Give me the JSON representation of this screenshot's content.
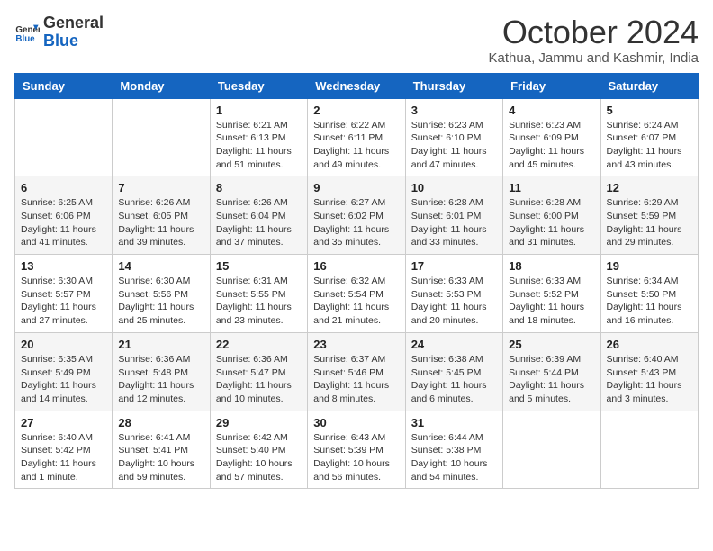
{
  "header": {
    "logo_line1": "General",
    "logo_line2": "Blue",
    "month": "October 2024",
    "location": "Kathua, Jammu and Kashmir, India"
  },
  "weekdays": [
    "Sunday",
    "Monday",
    "Tuesday",
    "Wednesday",
    "Thursday",
    "Friday",
    "Saturday"
  ],
  "weeks": [
    [
      {
        "day": "",
        "sunrise": "",
        "sunset": "",
        "daylight": ""
      },
      {
        "day": "",
        "sunrise": "",
        "sunset": "",
        "daylight": ""
      },
      {
        "day": "1",
        "sunrise": "Sunrise: 6:21 AM",
        "sunset": "Sunset: 6:13 PM",
        "daylight": "Daylight: 11 hours and 51 minutes."
      },
      {
        "day": "2",
        "sunrise": "Sunrise: 6:22 AM",
        "sunset": "Sunset: 6:11 PM",
        "daylight": "Daylight: 11 hours and 49 minutes."
      },
      {
        "day": "3",
        "sunrise": "Sunrise: 6:23 AM",
        "sunset": "Sunset: 6:10 PM",
        "daylight": "Daylight: 11 hours and 47 minutes."
      },
      {
        "day": "4",
        "sunrise": "Sunrise: 6:23 AM",
        "sunset": "Sunset: 6:09 PM",
        "daylight": "Daylight: 11 hours and 45 minutes."
      },
      {
        "day": "5",
        "sunrise": "Sunrise: 6:24 AM",
        "sunset": "Sunset: 6:07 PM",
        "daylight": "Daylight: 11 hours and 43 minutes."
      }
    ],
    [
      {
        "day": "6",
        "sunrise": "Sunrise: 6:25 AM",
        "sunset": "Sunset: 6:06 PM",
        "daylight": "Daylight: 11 hours and 41 minutes."
      },
      {
        "day": "7",
        "sunrise": "Sunrise: 6:26 AM",
        "sunset": "Sunset: 6:05 PM",
        "daylight": "Daylight: 11 hours and 39 minutes."
      },
      {
        "day": "8",
        "sunrise": "Sunrise: 6:26 AM",
        "sunset": "Sunset: 6:04 PM",
        "daylight": "Daylight: 11 hours and 37 minutes."
      },
      {
        "day": "9",
        "sunrise": "Sunrise: 6:27 AM",
        "sunset": "Sunset: 6:02 PM",
        "daylight": "Daylight: 11 hours and 35 minutes."
      },
      {
        "day": "10",
        "sunrise": "Sunrise: 6:28 AM",
        "sunset": "Sunset: 6:01 PM",
        "daylight": "Daylight: 11 hours and 33 minutes."
      },
      {
        "day": "11",
        "sunrise": "Sunrise: 6:28 AM",
        "sunset": "Sunset: 6:00 PM",
        "daylight": "Daylight: 11 hours and 31 minutes."
      },
      {
        "day": "12",
        "sunrise": "Sunrise: 6:29 AM",
        "sunset": "Sunset: 5:59 PM",
        "daylight": "Daylight: 11 hours and 29 minutes."
      }
    ],
    [
      {
        "day": "13",
        "sunrise": "Sunrise: 6:30 AM",
        "sunset": "Sunset: 5:57 PM",
        "daylight": "Daylight: 11 hours and 27 minutes."
      },
      {
        "day": "14",
        "sunrise": "Sunrise: 6:30 AM",
        "sunset": "Sunset: 5:56 PM",
        "daylight": "Daylight: 11 hours and 25 minutes."
      },
      {
        "day": "15",
        "sunrise": "Sunrise: 6:31 AM",
        "sunset": "Sunset: 5:55 PM",
        "daylight": "Daylight: 11 hours and 23 minutes."
      },
      {
        "day": "16",
        "sunrise": "Sunrise: 6:32 AM",
        "sunset": "Sunset: 5:54 PM",
        "daylight": "Daylight: 11 hours and 21 minutes."
      },
      {
        "day": "17",
        "sunrise": "Sunrise: 6:33 AM",
        "sunset": "Sunset: 5:53 PM",
        "daylight": "Daylight: 11 hours and 20 minutes."
      },
      {
        "day": "18",
        "sunrise": "Sunrise: 6:33 AM",
        "sunset": "Sunset: 5:52 PM",
        "daylight": "Daylight: 11 hours and 18 minutes."
      },
      {
        "day": "19",
        "sunrise": "Sunrise: 6:34 AM",
        "sunset": "Sunset: 5:50 PM",
        "daylight": "Daylight: 11 hours and 16 minutes."
      }
    ],
    [
      {
        "day": "20",
        "sunrise": "Sunrise: 6:35 AM",
        "sunset": "Sunset: 5:49 PM",
        "daylight": "Daylight: 11 hours and 14 minutes."
      },
      {
        "day": "21",
        "sunrise": "Sunrise: 6:36 AM",
        "sunset": "Sunset: 5:48 PM",
        "daylight": "Daylight: 11 hours and 12 minutes."
      },
      {
        "day": "22",
        "sunrise": "Sunrise: 6:36 AM",
        "sunset": "Sunset: 5:47 PM",
        "daylight": "Daylight: 11 hours and 10 minutes."
      },
      {
        "day": "23",
        "sunrise": "Sunrise: 6:37 AM",
        "sunset": "Sunset: 5:46 PM",
        "daylight": "Daylight: 11 hours and 8 minutes."
      },
      {
        "day": "24",
        "sunrise": "Sunrise: 6:38 AM",
        "sunset": "Sunset: 5:45 PM",
        "daylight": "Daylight: 11 hours and 6 minutes."
      },
      {
        "day": "25",
        "sunrise": "Sunrise: 6:39 AM",
        "sunset": "Sunset: 5:44 PM",
        "daylight": "Daylight: 11 hours and 5 minutes."
      },
      {
        "day": "26",
        "sunrise": "Sunrise: 6:40 AM",
        "sunset": "Sunset: 5:43 PM",
        "daylight": "Daylight: 11 hours and 3 minutes."
      }
    ],
    [
      {
        "day": "27",
        "sunrise": "Sunrise: 6:40 AM",
        "sunset": "Sunset: 5:42 PM",
        "daylight": "Daylight: 11 hours and 1 minute."
      },
      {
        "day": "28",
        "sunrise": "Sunrise: 6:41 AM",
        "sunset": "Sunset: 5:41 PM",
        "daylight": "Daylight: 10 hours and 59 minutes."
      },
      {
        "day": "29",
        "sunrise": "Sunrise: 6:42 AM",
        "sunset": "Sunset: 5:40 PM",
        "daylight": "Daylight: 10 hours and 57 minutes."
      },
      {
        "day": "30",
        "sunrise": "Sunrise: 6:43 AM",
        "sunset": "Sunset: 5:39 PM",
        "daylight": "Daylight: 10 hours and 56 minutes."
      },
      {
        "day": "31",
        "sunrise": "Sunrise: 6:44 AM",
        "sunset": "Sunset: 5:38 PM",
        "daylight": "Daylight: 10 hours and 54 minutes."
      },
      {
        "day": "",
        "sunrise": "",
        "sunset": "",
        "daylight": ""
      },
      {
        "day": "",
        "sunrise": "",
        "sunset": "",
        "daylight": ""
      }
    ]
  ]
}
